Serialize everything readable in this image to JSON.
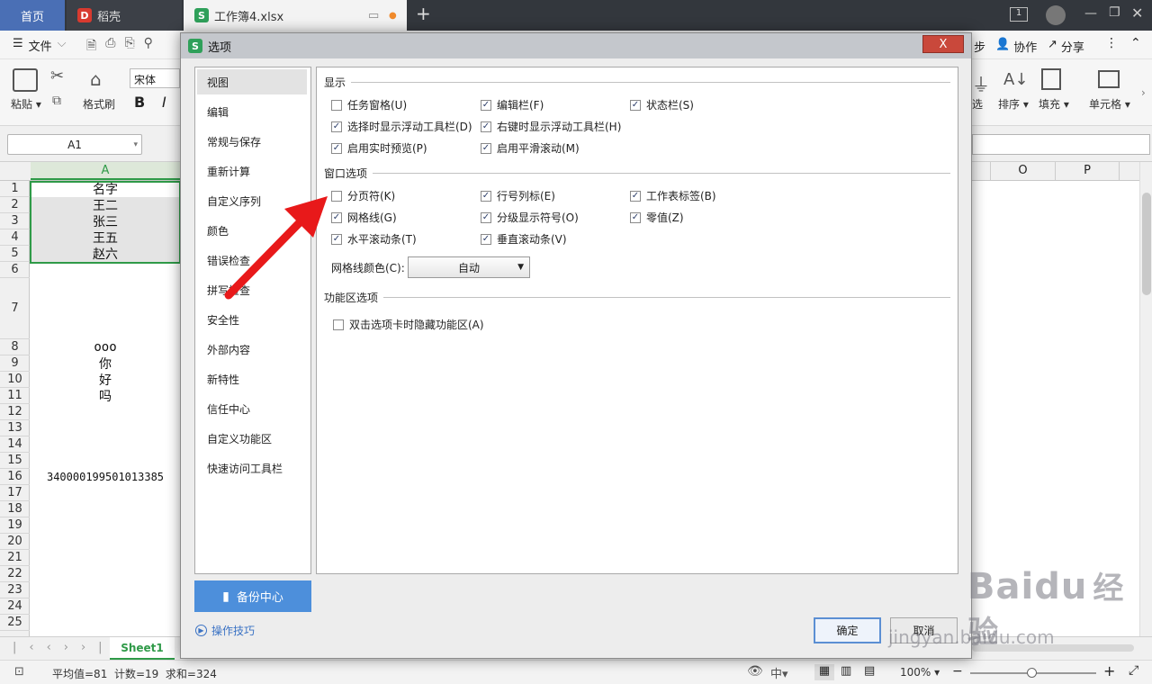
{
  "titlebar": {
    "tabs": [
      {
        "label": "首页"
      },
      {
        "label": "稻壳"
      },
      {
        "label": "工作簿4.xlsx"
      }
    ],
    "new_tab": "+",
    "window_count": "1"
  },
  "menu": {
    "file": "文件",
    "sync": "步",
    "collaborate": "协作",
    "share": "分享"
  },
  "ribbon": {
    "paste": "粘贴",
    "format_painter": "格式刷",
    "font": "宋体",
    "bold": "B",
    "italic": "I",
    "sort": "排序",
    "fill": "填充",
    "cell": "单元格",
    "filter_tail": "选"
  },
  "namebox": "A1",
  "columns": {
    "a": "A",
    "o": "O",
    "p": "P"
  },
  "rows": [
    "1",
    "2",
    "3",
    "4",
    "5",
    "6",
    "7",
    "8",
    "9",
    "10",
    "11",
    "12",
    "13",
    "14",
    "15",
    "16",
    "17",
    "18",
    "19",
    "20",
    "21",
    "22",
    "23",
    "24",
    "25"
  ],
  "cells": {
    "r1": "名字",
    "r2": "王二",
    "r3": "张三",
    "r4": "王五",
    "r5": "赵六",
    "r8": "ooo",
    "r9": "你",
    "r10": "好",
    "r11": "吗",
    "r16": "340000199501013385"
  },
  "sheet_tab": "Sheet1",
  "status": {
    "summary": "平均值=81  计数=19  求和=324",
    "zoom": "100%"
  },
  "dialog": {
    "title": "选项",
    "close": "X",
    "nav": [
      "视图",
      "编辑",
      "常规与保存",
      "重新计算",
      "自定义序列",
      "颜色",
      "错误检查",
      "拼写检查",
      "安全性",
      "外部内容",
      "新特性",
      "信任中心",
      "自定义功能区",
      "快速访问工具栏"
    ],
    "selected_nav": "视图",
    "backup": "备份中心",
    "tips": "操作技巧",
    "ok": "确定",
    "cancel": "取消",
    "sections": {
      "display": {
        "title": "显示",
        "options": [
          {
            "label": "任务窗格(U)",
            "checked": false
          },
          {
            "label": "编辑栏(F)",
            "checked": true
          },
          {
            "label": "状态栏(S)",
            "checked": true
          },
          {
            "label": "选择时显示浮动工具栏(D)",
            "checked": true
          },
          {
            "label": "右键时显示浮动工具栏(H)",
            "checked": true
          },
          {
            "label": "启用实时预览(P)",
            "checked": true
          },
          {
            "label": "启用平滑滚动(M)",
            "checked": true
          }
        ]
      },
      "window": {
        "title": "窗口选项",
        "options": [
          {
            "label": "分页符(K)",
            "checked": false
          },
          {
            "label": "行号列标(E)",
            "checked": true
          },
          {
            "label": "工作表标签(B)",
            "checked": true
          },
          {
            "label": "网格线(G)",
            "checked": true
          },
          {
            "label": "分级显示符号(O)",
            "checked": true
          },
          {
            "label": "零值(Z)",
            "checked": true
          },
          {
            "label": "水平滚动条(T)",
            "checked": true
          },
          {
            "label": "垂直滚动条(V)",
            "checked": true
          }
        ],
        "gridline_color_label": "网格线颜色(C):",
        "gridline_color_value": "自动"
      },
      "ribbon_section": {
        "title": "功能区选项",
        "options": [
          {
            "label": "双击选项卡时隐藏功能区(A)",
            "checked": false
          }
        ]
      }
    }
  },
  "watermark": {
    "brand": "Baidu",
    "brand_cn": "经验",
    "url": "jingyan.baidu.com"
  },
  "colors": {
    "accent": "#4d8fdb",
    "selection": "#2f9a48",
    "arrow": "#e8191a"
  }
}
